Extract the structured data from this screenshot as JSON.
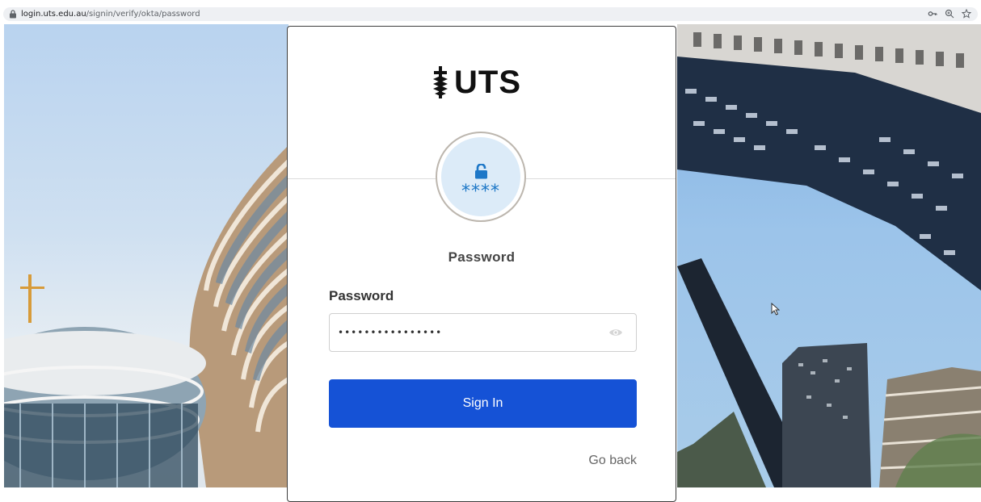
{
  "browser": {
    "url_host": "login.uts.edu.au",
    "url_path": "/signin/verify/okta/password",
    "icons": [
      "lock-icon",
      "key-icon",
      "zoom-icon",
      "star-icon"
    ]
  },
  "card": {
    "logo_text": "UTS",
    "authenticator_icon": "password-lock-icon",
    "authenticator_stars": "****",
    "heading": "Password",
    "password_label": "Password",
    "password_value": "••••••••••••••••",
    "reveal_icon": "eye-icon",
    "signin_label": "Sign In",
    "goback_label": "Go back"
  },
  "colors": {
    "primary_button": "#1552d6",
    "authenticator_bg": "#dcebf8",
    "authenticator_accent": "#1d77c7"
  }
}
